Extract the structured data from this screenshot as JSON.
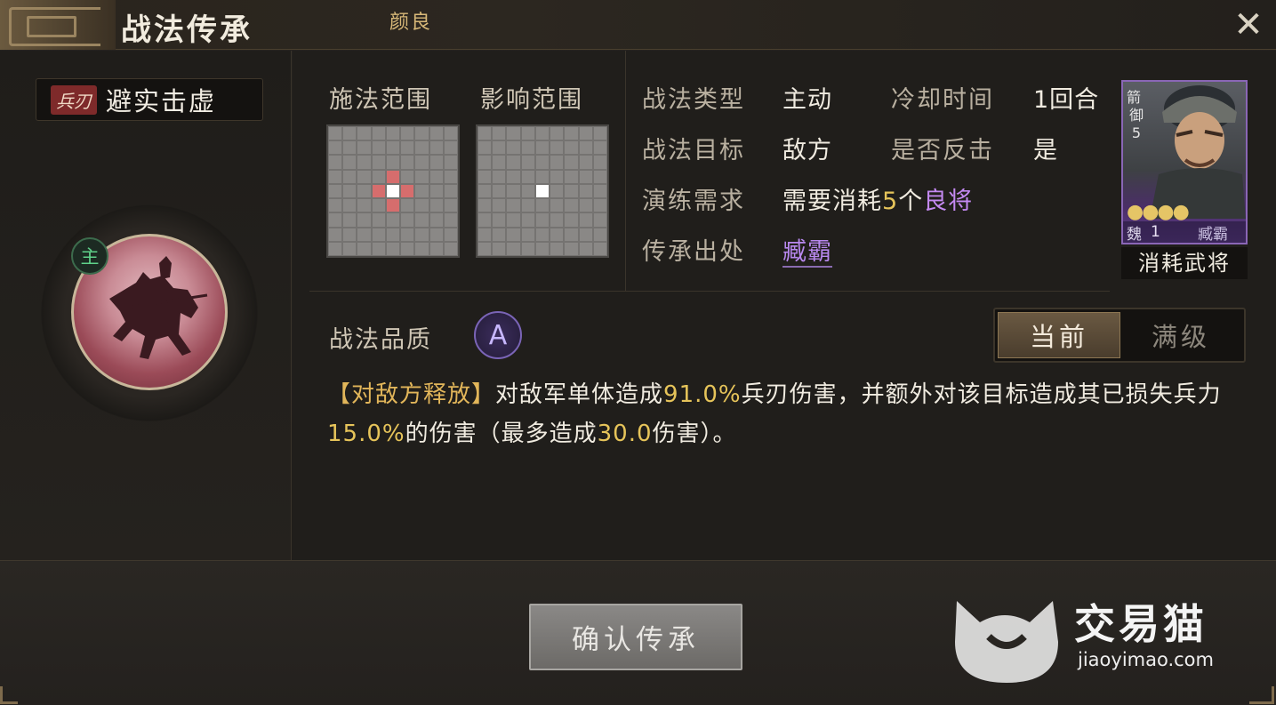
{
  "header": {
    "title": "战法传承",
    "subtitle": "颜良"
  },
  "skill": {
    "type_badge": "兵刃",
    "name": "避实击虚",
    "main_marker": "主"
  },
  "ranges": {
    "cast_label": "施法范围",
    "effect_label": "影响范围"
  },
  "info": {
    "type_key": "战法类型",
    "type_val": "主动",
    "cd_key": "冷却时间",
    "cd_val": "1回合",
    "target_key": "战法目标",
    "target_val": "敌方",
    "counter_key": "是否反击",
    "counter_val": "是",
    "req_key": "演练需求",
    "req_prefix": "需要消耗",
    "req_count": "5",
    "req_unit": "个",
    "req_quality": "良将",
    "source_key": "传承出处",
    "source_val": "臧霸"
  },
  "card": {
    "top_icon": "箭",
    "rank_label": "御",
    "rank_level": "5",
    "stars": "●●●●",
    "kingdom": "魏",
    "level": "1",
    "general_name": "臧霸",
    "caption": "消耗武将"
  },
  "quality": {
    "label": "战法品质",
    "grade": "A"
  },
  "toggle": {
    "current": "当前",
    "max": "满级"
  },
  "description": {
    "tag": "【对敌方释放】",
    "p1": "对敌军单体造成",
    "v1": "91.0%",
    "p2": "兵刃伤害，并额外对该目标造成其已损失兵力",
    "v2": "15.0%",
    "p3": "的伤害（最多造成",
    "v3": "30.0",
    "p4": "伤害）。"
  },
  "confirm_label": "确认传承",
  "watermark": {
    "name": "交易猫",
    "url": "jiaoyimao.com"
  },
  "colors": {
    "accent_yellow": "#e6c45a",
    "accent_purple": "#c489f2",
    "hit_red": "#d66d6d"
  }
}
